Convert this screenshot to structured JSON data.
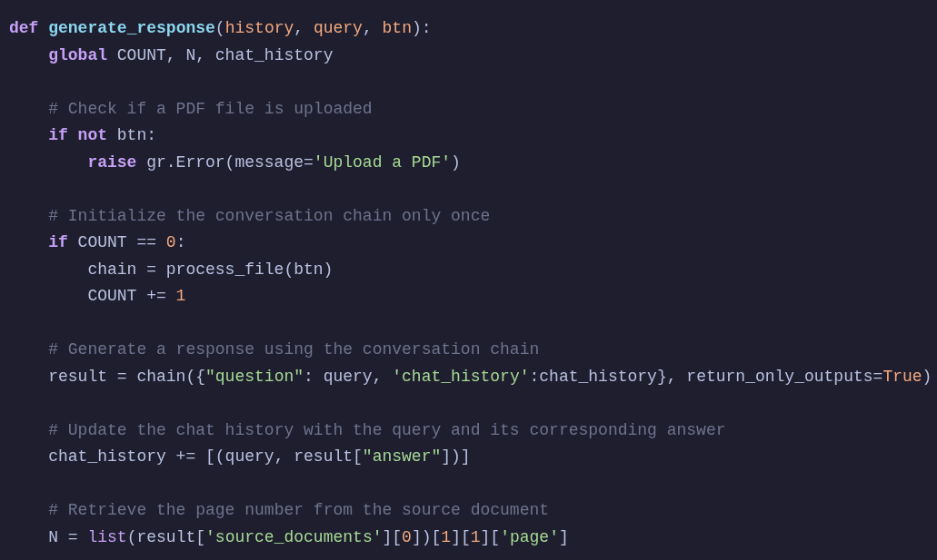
{
  "code_lines": [
    {
      "kind": "code",
      "tokens": [
        {
          "kind": "keyword",
          "text": "def "
        },
        {
          "kind": "function",
          "text": "generate_response"
        },
        {
          "kind": "plain",
          "text": "("
        },
        {
          "kind": "param",
          "text": "history"
        },
        {
          "kind": "plain",
          "text": ", "
        },
        {
          "kind": "param",
          "text": "query"
        },
        {
          "kind": "plain",
          "text": ", "
        },
        {
          "kind": "param",
          "text": "btn"
        },
        {
          "kind": "plain",
          "text": "):"
        }
      ],
      "children": [
        {
          "kind": "code",
          "tokens": [
            {
              "kind": "keyword",
              "text": "global"
            },
            {
              "kind": "plain",
              "text": " COUNT, N, chat_history"
            }
          ]
        },
        {
          "kind": "blank"
        },
        {
          "kind": "code",
          "tokens": [
            {
              "kind": "comment",
              "text": "# Check if a PDF file is uploaded"
            }
          ]
        },
        {
          "kind": "code",
          "tokens": [
            {
              "kind": "keyword",
              "text": "if "
            },
            {
              "kind": "keyword",
              "text": "not"
            },
            {
              "kind": "plain",
              "text": " btn:"
            }
          ],
          "children": [
            {
              "kind": "code",
              "tokens": [
                {
                  "kind": "keyword",
                  "text": "raise"
                },
                {
                  "kind": "plain",
                  "text": " gr.Error(message="
                },
                {
                  "kind": "string",
                  "text": "'Upload a PDF'"
                },
                {
                  "kind": "plain",
                  "text": ")"
                }
              ]
            }
          ]
        },
        {
          "kind": "blank"
        },
        {
          "kind": "code",
          "tokens": [
            {
              "kind": "comment",
              "text": "# Initialize the conversation chain only once"
            }
          ]
        },
        {
          "kind": "code",
          "tokens": [
            {
              "kind": "keyword",
              "text": "if"
            },
            {
              "kind": "plain",
              "text": " COUNT == "
            },
            {
              "kind": "number",
              "text": "0"
            },
            {
              "kind": "plain",
              "text": ":"
            }
          ],
          "children": [
            {
              "kind": "code",
              "tokens": [
                {
                  "kind": "plain",
                  "text": "chain = process_file(btn)"
                }
              ]
            },
            {
              "kind": "code",
              "tokens": [
                {
                  "kind": "plain",
                  "text": "COUNT += "
                },
                {
                  "kind": "number",
                  "text": "1"
                }
              ]
            }
          ]
        },
        {
          "kind": "blank"
        },
        {
          "kind": "code",
          "tokens": [
            {
              "kind": "comment",
              "text": "# Generate a response using the conversation chain"
            }
          ]
        },
        {
          "kind": "code",
          "tokens": [
            {
              "kind": "plain",
              "text": "result = chain({"
            },
            {
              "kind": "string",
              "text": "\"question\""
            },
            {
              "kind": "plain",
              "text": ": query, "
            },
            {
              "kind": "string",
              "text": "'chat_history'"
            },
            {
              "kind": "plain",
              "text": ":chat_history}, return_only_outputs="
            },
            {
              "kind": "number",
              "text": "True"
            },
            {
              "kind": "plain",
              "text": ")"
            }
          ]
        },
        {
          "kind": "blank"
        },
        {
          "kind": "code",
          "tokens": [
            {
              "kind": "comment",
              "text": "# Update the chat history with the query and its corresponding answer"
            }
          ]
        },
        {
          "kind": "code",
          "tokens": [
            {
              "kind": "plain",
              "text": "chat_history += [(query, result["
            },
            {
              "kind": "string",
              "text": "\"answer\""
            },
            {
              "kind": "plain",
              "text": "])]"
            }
          ]
        },
        {
          "kind": "blank"
        },
        {
          "kind": "code",
          "tokens": [
            {
              "kind": "comment",
              "text": "# Retrieve the page number from the source document"
            }
          ]
        },
        {
          "kind": "code",
          "tokens": [
            {
              "kind": "plain",
              "text": "N = "
            },
            {
              "kind": "builtin",
              "text": "list"
            },
            {
              "kind": "plain",
              "text": "(result["
            },
            {
              "kind": "string",
              "text": "'source_documents'"
            },
            {
              "kind": "plain",
              "text": "]["
            },
            {
              "kind": "number",
              "text": "0"
            },
            {
              "kind": "plain",
              "text": "])["
            },
            {
              "kind": "number",
              "text": "1"
            },
            {
              "kind": "plain",
              "text": "]["
            },
            {
              "kind": "number",
              "text": "1"
            },
            {
              "kind": "plain",
              "text": "]["
            },
            {
              "kind": "string",
              "text": "'page'"
            },
            {
              "kind": "plain",
              "text": "]"
            }
          ]
        }
      ]
    }
  ]
}
